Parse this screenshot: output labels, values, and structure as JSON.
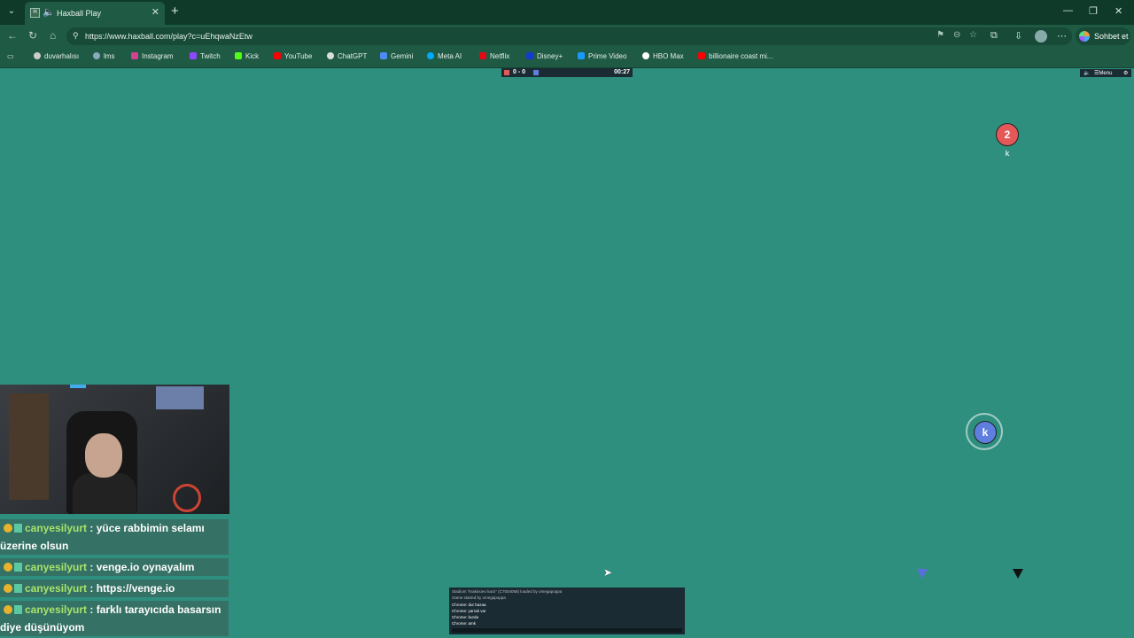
{
  "browser": {
    "tab_title": "Haxball Play",
    "url": "https://www.haxball.com/play?c=uEhqwaNzEtw",
    "copilot_label": "Sohbet et",
    "bookmarks": [
      "duvarhalısı",
      "lms",
      "Instagram",
      "Twitch",
      "Kick",
      "YouTube",
      "ChatGPT",
      "Gemini",
      "Meta AI",
      "Netflix",
      "Disney+",
      "Prime Video",
      "HBO Max",
      "billionaire coast mi..."
    ]
  },
  "game": {
    "score": "0 - 0",
    "time": "00:27",
    "menu_label": "Menu",
    "red_player": {
      "number": "2",
      "name": "k"
    },
    "blue_player": {
      "avatar": "k"
    },
    "chat": [
      "Stadium \"krakinoeo kaciı\" (C7004058) loaded by omegapoppa",
      "Game started by omegapoppa",
      "Chrome: dur bazaa",
      "Chrome: yarrak var",
      "Chrome: burda",
      "Chrome: amk"
    ]
  },
  "stream_chat": [
    {
      "user": "canyesilyurt",
      "text": " : yüce rabbimin selamı üzerine olsun"
    },
    {
      "user": "canyesilyurt",
      "text": " : venge.io oynayalım"
    },
    {
      "user": "canyesilyurt",
      "text": " : https://venge.io"
    },
    {
      "user": "canyesilyurt",
      "text": " : farklı tarayıcıda basarsın diye düşünüyom"
    }
  ],
  "colors": {
    "pitch": "#2f8f7f",
    "red_team": "#e45858",
    "blue_team": "#5e7fe0",
    "browser_frame": "#1f5a44"
  }
}
